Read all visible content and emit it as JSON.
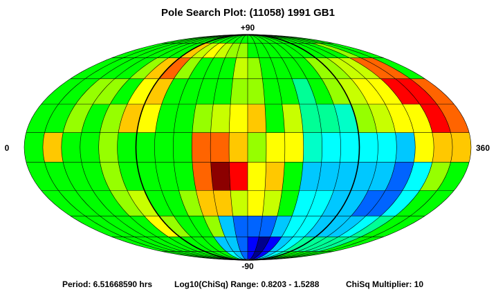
{
  "title": "Pole Search Plot: (11058) 1991 GB1",
  "footer": {
    "period": "Period: 6.51668590 hrs",
    "range": "Log10(ChiSq) Range: 0.8203 - 1.5288",
    "multiplier": "ChiSq Multiplier: 10"
  },
  "chart_data": {
    "type": "heatmap",
    "projection": "Mollweide",
    "title": "Pole Search Plot: (11058) 1991 GB1",
    "x_labels": {
      "left": "0",
      "right": "360"
    },
    "y_labels": {
      "top": "+90",
      "bottom": "-90"
    },
    "xlim": [
      0,
      360
    ],
    "ylim": [
      -90,
      90
    ],
    "lon_step_deg": 15,
    "lat_step_deg": 15,
    "lat_rows": [
      75,
      60,
      45,
      30,
      15,
      0,
      -15,
      -30,
      -45,
      -60,
      -75
    ],
    "palette_low_to_high": [
      "#00008c",
      "#0000ff",
      "#0064ff",
      "#00c8ff",
      "#00ffff",
      "#00ffc8",
      "#00ff96",
      "#00ff00",
      "#96ff00",
      "#c8ff00",
      "#ffff00",
      "#ffc800",
      "#ff6400",
      "#ff0000",
      "#8c0000"
    ],
    "levels_by_row": [
      [
        7,
        7,
        7,
        7,
        7,
        7,
        7,
        7,
        7,
        7,
        7,
        7,
        7,
        7,
        7,
        7,
        7,
        7,
        7,
        7,
        7,
        7,
        7,
        7
      ],
      [
        7,
        7,
        7,
        7,
        7,
        7,
        11,
        9,
        10,
        9,
        8,
        8,
        7,
        7,
        7,
        7,
        7,
        7,
        7,
        7,
        7,
        8,
        7,
        7
      ],
      [
        7,
        7,
        7,
        7,
        8,
        11,
        12,
        8,
        7,
        7,
        7,
        9,
        8,
        7,
        7,
        7,
        7,
        8,
        8,
        9,
        9,
        12,
        12,
        7
      ],
      [
        7,
        7,
        8,
        8,
        7,
        10,
        11,
        7,
        7,
        7,
        7,
        8,
        8,
        7,
        7,
        6,
        7,
        8,
        9,
        10,
        10,
        13,
        13,
        12
      ],
      [
        7,
        7,
        8,
        7,
        8,
        11,
        10,
        7,
        7,
        8,
        9,
        10,
        11,
        7,
        9,
        6,
        6,
        5,
        8,
        9,
        10,
        10,
        13,
        12
      ],
      [
        7,
        11,
        7,
        7,
        8,
        7,
        7,
        7,
        7,
        12,
        12,
        11,
        8,
        10,
        10,
        5,
        4,
        4,
        4,
        4,
        3,
        10,
        11,
        11
      ],
      [
        7,
        7,
        7,
        7,
        8,
        7,
        7,
        7,
        7,
        12,
        14,
        13,
        10,
        11,
        7,
        3,
        3,
        3,
        3,
        3,
        2,
        4,
        8,
        7
      ],
      [
        7,
        7,
        7,
        7,
        8,
        9,
        7,
        7,
        8,
        11,
        11,
        9,
        10,
        9,
        7,
        4,
        4,
        3,
        3,
        2,
        2,
        4,
        7,
        7
      ],
      [
        7,
        7,
        7,
        7,
        7,
        10,
        8,
        7,
        7,
        8,
        3,
        2,
        2,
        2,
        3,
        4,
        4,
        3,
        3,
        3,
        4,
        6,
        7,
        7
      ],
      [
        7,
        7,
        7,
        7,
        7,
        7,
        7,
        7,
        7,
        3,
        3,
        2,
        1,
        0,
        1,
        3,
        4,
        6,
        6,
        6,
        6,
        6,
        7,
        7
      ],
      [
        7,
        7,
        7,
        7,
        7,
        7,
        7,
        7,
        7,
        4,
        3,
        2,
        1,
        0,
        1,
        3,
        4,
        6,
        7,
        7,
        7,
        7,
        7,
        7
      ]
    ]
  }
}
